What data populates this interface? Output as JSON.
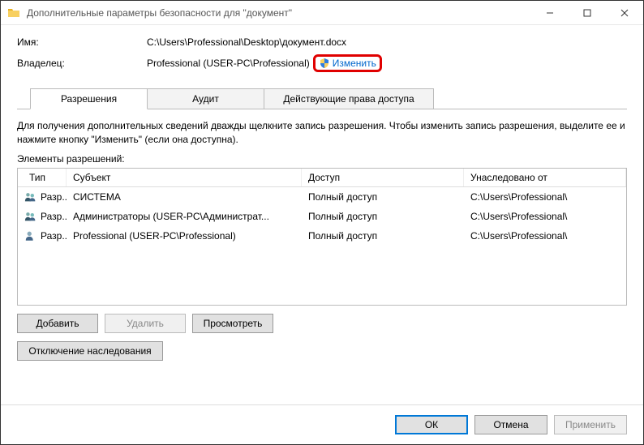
{
  "window": {
    "title": "Дополнительные параметры безопасности  для \"документ\""
  },
  "info": {
    "name_label": "Имя:",
    "name_value": "C:\\Users\\Professional\\Desktop\\документ.docx",
    "owner_label": "Владелец:",
    "owner_value": "Professional (USER-PC\\Professional)",
    "change_link": "Изменить"
  },
  "tabs": {
    "permissions": "Разрешения",
    "audit": "Аудит",
    "effective": "Действующие права доступа"
  },
  "help_text": "Для получения дополнительных сведений дважды щелкните запись разрешения. Чтобы изменить запись разрешения, выделите ее и нажмите кнопку \"Изменить\" (если она доступна).",
  "elements_label": "Элементы разрешений:",
  "columns": {
    "type": "Тип",
    "subject": "Субъект",
    "access": "Доступ",
    "inherited": "Унаследовано от"
  },
  "rows": [
    {
      "type": "Разр...",
      "subject": "СИСТЕМА",
      "access": "Полный доступ",
      "inherited": "C:\\Users\\Professional\\"
    },
    {
      "type": "Разр...",
      "subject": "Администраторы (USER-PC\\Администрат...",
      "access": "Полный доступ",
      "inherited": "C:\\Users\\Professional\\"
    },
    {
      "type": "Разр...",
      "subject": "Professional (USER-PC\\Professional)",
      "access": "Полный доступ",
      "inherited": "C:\\Users\\Professional\\"
    }
  ],
  "buttons": {
    "add": "Добавить",
    "remove": "Удалить",
    "view": "Просмотреть",
    "disable_inherit": "Отключение наследования",
    "ok": "ОК",
    "cancel": "Отмена",
    "apply": "Применить"
  }
}
